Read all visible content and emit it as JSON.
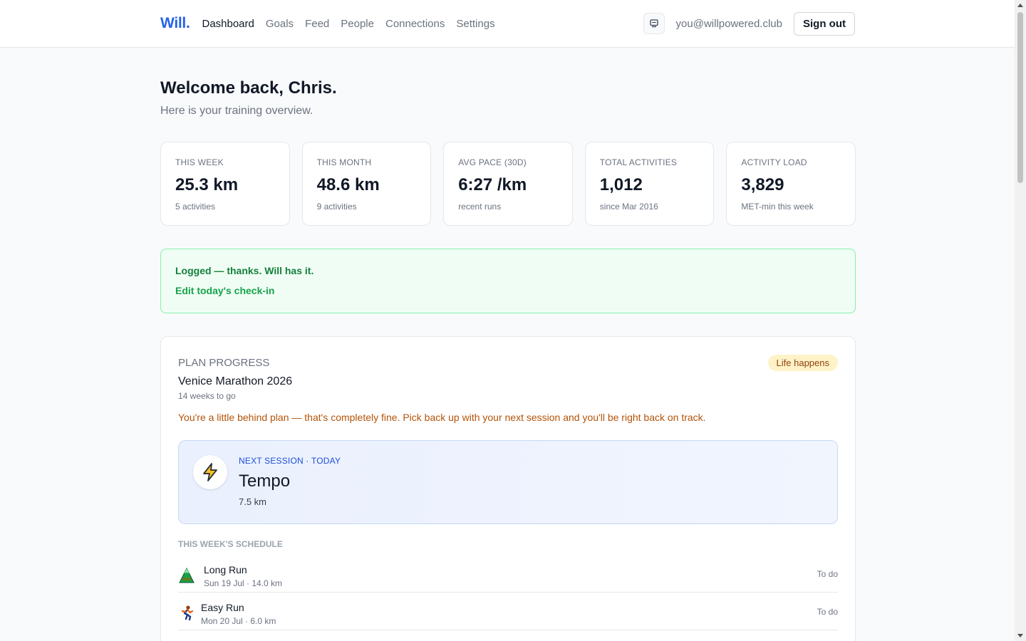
{
  "header": {
    "logo": "Will.",
    "nav": [
      "Dashboard",
      "Goals",
      "Feed",
      "People",
      "Connections",
      "Settings"
    ],
    "active_nav": "Dashboard",
    "device_icon": "monitor-icon",
    "email": "you@willpowered.club",
    "sign_out": "Sign out"
  },
  "welcome": {
    "title": "Welcome back, Chris.",
    "subtitle": "Here is your training overview."
  },
  "stats": [
    {
      "label": "THIS WEEK",
      "value": "25.3 km",
      "sub": "5 activities"
    },
    {
      "label": "THIS MONTH",
      "value": "48.6 km",
      "sub": "9 activities"
    },
    {
      "label": "AVG PACE (30D)",
      "value": "6:27 /km",
      "sub": "recent runs"
    },
    {
      "label": "TOTAL ACTIVITIES",
      "value": "1,012",
      "sub": "since Mar 2016"
    },
    {
      "label": "ACTIVITY LOAD",
      "value": "3,829",
      "sub": "MET-min this week"
    }
  ],
  "checkin": {
    "message": "Logged — thanks. Will has it.",
    "link": "Edit today's check-in"
  },
  "plan": {
    "label": "PLAN PROGRESS",
    "badge": "Life happens",
    "title": "Venice Marathon 2026",
    "weeks": "14 weeks to go",
    "note": "You're a little behind plan — that's completely fine. Pick back up with your next session and you'll be right back on track.",
    "next_session": {
      "label": "NEXT SESSION · TODAY",
      "title": "Tempo",
      "distance": "7.5 km",
      "icon": "lightning-icon"
    },
    "schedule_label": "THIS WEEK'S SCHEDULE",
    "schedule": [
      {
        "name": "Long Run",
        "meta": "Sun 19 Jul · 14.0 km",
        "status": "To do",
        "icon": "mountain-icon"
      },
      {
        "name": "Easy Run",
        "meta": "Mon 20 Jul · 6.0 km",
        "status": "To do",
        "icon": "runner-icon"
      }
    ]
  },
  "colors": {
    "brand": "#2563eb",
    "success_bg": "#f0fdf4",
    "success_text": "#15803d",
    "warning_text": "#b45309",
    "badge_bg": "#fef3c7"
  }
}
